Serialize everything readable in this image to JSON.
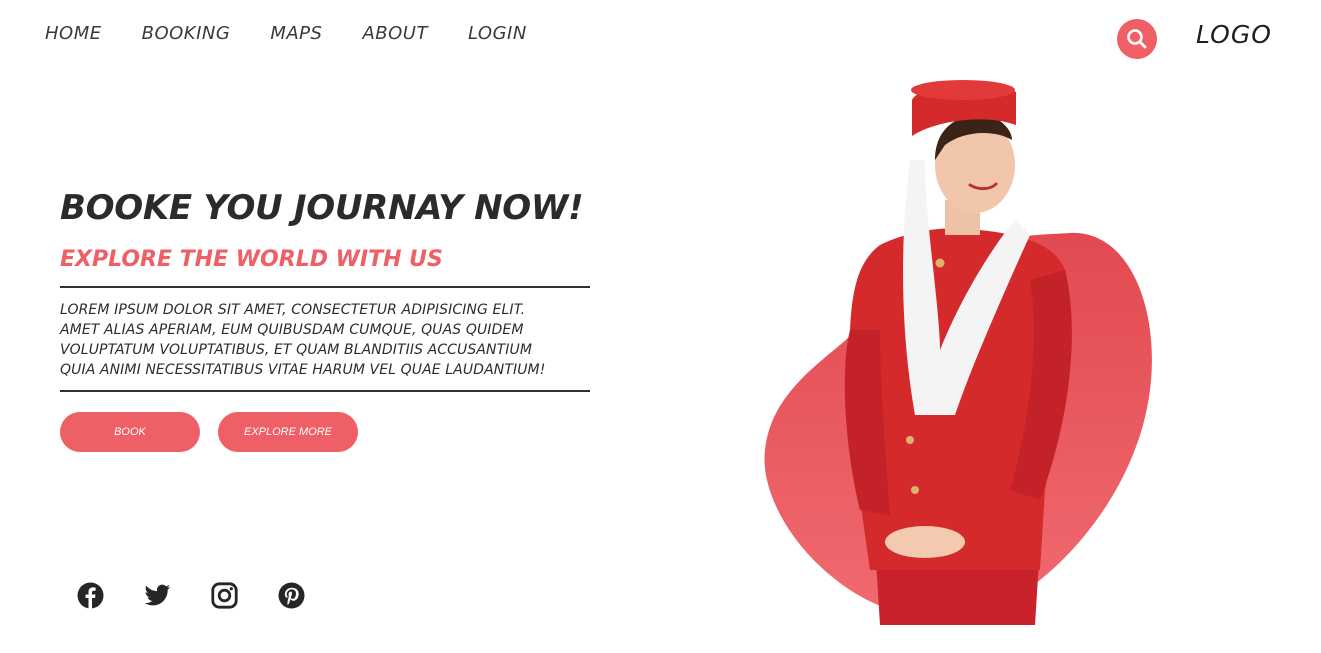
{
  "nav": {
    "items": [
      {
        "label": "HOME"
      },
      {
        "label": "BOOKING"
      },
      {
        "label": "MAPS"
      },
      {
        "label": "ABOUT"
      },
      {
        "label": "LOGIN"
      }
    ]
  },
  "header": {
    "search_icon": "search-icon",
    "logo": "LOGO"
  },
  "hero": {
    "title": "BOOKE YOU JOURNAY NOW!",
    "subtitle": "EXPLORE THE WORLD WITH US",
    "body_lines": [
      "LOREM IPSUM DOLOR SIT AMET, CONSECTETUR ADIPISICING ELIT.",
      "AMET ALIAS APERIAM, EUM QUIBUSDAM CUMQUE, QUAS QUIDEM",
      "VOLUPTATUM VOLUPTATIBUS, ET QUAM BLANDITIIS ACCUSANTIUM",
      "QUIA ANIMI NECESSITATIBUS VITAE HARUM VEL QUAE LAUDANTIUM!"
    ],
    "book_label": "BOOK",
    "explore_label": "EXPLORE MORE"
  },
  "social": [
    "facebook-icon",
    "twitter-icon",
    "instagram-icon",
    "pinterest-icon"
  ],
  "colors": {
    "accent": "#ef5f66",
    "text": "#2b2b2b",
    "uniform_red": "#d42a2b"
  }
}
